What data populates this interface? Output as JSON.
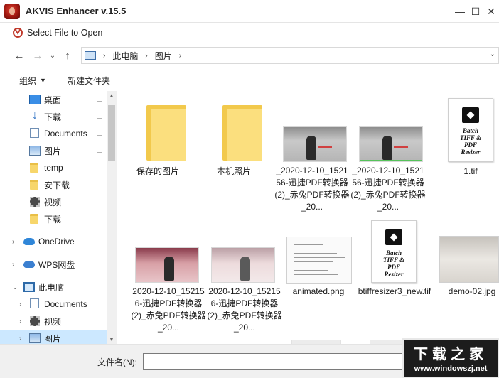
{
  "app": {
    "title": "AKVIS Enhancer v.15.5",
    "controls": {
      "minimize": "—",
      "maximize": "☐",
      "close": "✕"
    }
  },
  "dialog": {
    "title": "Select File to Open"
  },
  "nav": {
    "back": "←",
    "forward": "→",
    "recent": "⌄",
    "up": "↑",
    "breadcrumb": [
      "此电脑",
      "图片"
    ],
    "separator": "›",
    "dropdown": "⌄"
  },
  "toolbar": {
    "organize": "组织",
    "organize_caret": "▼",
    "new_folder": "新建文件夹"
  },
  "sidebar": {
    "items": [
      {
        "label": "桌面",
        "icon": "desktop-icon",
        "pinned": true
      },
      {
        "label": "下载",
        "icon": "download-icon",
        "pinned": true
      },
      {
        "label": "Documents",
        "icon": "documents-icon",
        "pinned": true
      },
      {
        "label": "图片",
        "icon": "pictures-icon",
        "pinned": true
      },
      {
        "label": "temp",
        "icon": "folder-icon",
        "pinned": false
      },
      {
        "label": "安下载",
        "icon": "folder-icon",
        "pinned": false
      },
      {
        "label": "视频",
        "icon": "video-icon",
        "pinned": false
      },
      {
        "label": "下载",
        "icon": "folder-icon",
        "pinned": false
      },
      {
        "label": "OneDrive",
        "icon": "onedrive-icon",
        "expander": "›"
      },
      {
        "label": "WPS网盘",
        "icon": "wps-cloud-icon",
        "expander": "›"
      },
      {
        "label": "此电脑",
        "icon": "computer-icon",
        "expander": "⌄"
      },
      {
        "label": "Documents",
        "icon": "documents-icon",
        "expander": "›"
      },
      {
        "label": "视频",
        "icon": "video-icon",
        "expander": "›"
      },
      {
        "label": "图片",
        "icon": "pictures-icon",
        "expander": "›",
        "selected": true
      }
    ],
    "pin_glyph": "📌"
  },
  "files": [
    {
      "name": "保存的图片",
      "type": "folder"
    },
    {
      "name": "本机照片",
      "type": "folder"
    },
    {
      "name": "_2020-12-10_152156-迅捷PDF转换器 (2)_赤兔PDF转换器_20...",
      "type": "photo"
    },
    {
      "name": "_2020-12-10_152156-迅捷PDF转换器 (2)_赤兔PDF转换器_20...",
      "type": "photo"
    },
    {
      "name": "1.tif",
      "type": "tif"
    },
    {
      "name": "2020-12-10_152156-迅捷PDF转换器 (2)_赤兔PDF转换器_20...",
      "type": "photo"
    },
    {
      "name": "2020-12-10_152156-迅捷PDF转换器 (2)_赤兔PDF转换器_20...",
      "type": "photo"
    },
    {
      "name": "animated.png",
      "type": "doc"
    },
    {
      "name": "btiffresizer3_new.tif",
      "type": "tif"
    },
    {
      "name": "demo-02.jpg",
      "type": "photo"
    }
  ],
  "tif_cover": {
    "line1": "Batch",
    "line2": "TIFF &",
    "line3": "PDF",
    "line4": "Resizer"
  },
  "bottom": {
    "filename_label": "文件名(N):",
    "filename_value": ""
  },
  "watermark": {
    "title": "下载之家",
    "url": "www.windowszj.net"
  }
}
